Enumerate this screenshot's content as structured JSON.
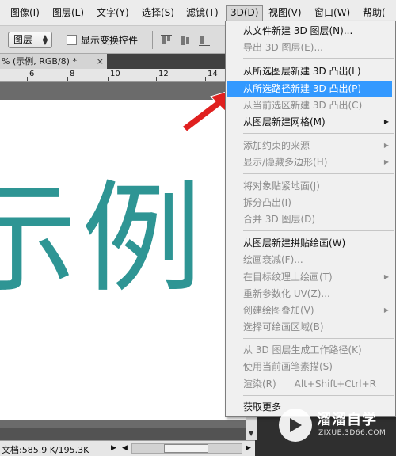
{
  "menubar": {
    "items": [
      "图像(I)",
      "图层(L)",
      "文字(Y)",
      "选择(S)",
      "滤镜(T)",
      "3D(D)",
      "视图(V)",
      "窗口(W)",
      "帮助("
    ]
  },
  "optionsbar": {
    "layer_select": "图层",
    "show_transform_label": "显示变换控件"
  },
  "document": {
    "tab_label": "% (示例, RGB/8) *",
    "tab_close": "×",
    "ruler_numbers": [
      "6",
      "8",
      "10",
      "12",
      "14"
    ],
    "canvas_text": "示例",
    "canvas_text_color": "#2e9594"
  },
  "status": {
    "text": "文档:585.9 K/195.3K"
  },
  "menu_3d": {
    "highlight_color": "#3399ff",
    "items": [
      {
        "label": "从文件新建 3D 图层(N)...",
        "enabled": true,
        "submenu": false,
        "highlight": false
      },
      {
        "label": "导出 3D 图层(E)...",
        "enabled": false,
        "submenu": false,
        "highlight": false
      },
      {
        "label": "从所选图层新建 3D 凸出(L)",
        "enabled": true,
        "submenu": false,
        "highlight": false
      },
      {
        "label": "从所选路径新建 3D 凸出(P)",
        "enabled": true,
        "submenu": false,
        "highlight": true
      },
      {
        "label": "从当前选区新建 3D 凸出(C)",
        "enabled": false,
        "submenu": false,
        "highlight": false
      },
      {
        "label": "从图层新建网格(M)",
        "enabled": true,
        "submenu": true,
        "highlight": false
      },
      {
        "label": "添加约束的来源",
        "enabled": false,
        "submenu": true,
        "highlight": false
      },
      {
        "label": "显示/隐藏多边形(H)",
        "enabled": false,
        "submenu": true,
        "highlight": false
      },
      {
        "label": "将对象贴紧地面(J)",
        "enabled": false,
        "submenu": false,
        "highlight": false
      },
      {
        "label": "拆分凸出(I)",
        "enabled": false,
        "submenu": false,
        "highlight": false
      },
      {
        "label": "合并 3D 图层(D)",
        "enabled": false,
        "submenu": false,
        "highlight": false
      },
      {
        "label": "从图层新建拼贴绘画(W)",
        "enabled": true,
        "submenu": false,
        "highlight": false
      },
      {
        "label": "绘画衰减(F)...",
        "enabled": false,
        "submenu": false,
        "highlight": false
      },
      {
        "label": "在目标纹理上绘画(T)",
        "enabled": false,
        "submenu": true,
        "highlight": false
      },
      {
        "label": "重新参数化 UV(Z)...",
        "enabled": false,
        "submenu": false,
        "highlight": false
      },
      {
        "label": "创建绘图叠加(V)",
        "enabled": false,
        "submenu": true,
        "highlight": false
      },
      {
        "label": "选择可绘画区域(B)",
        "enabled": false,
        "submenu": false,
        "highlight": false
      },
      {
        "label": "从 3D 图层生成工作路径(K)",
        "enabled": false,
        "submenu": false,
        "highlight": false
      },
      {
        "label": "使用当前画笔素描(S)",
        "enabled": false,
        "submenu": false,
        "highlight": false
      },
      {
        "label": "渲染(R)",
        "enabled": false,
        "submenu": false,
        "highlight": false,
        "shortcut": "Alt+Shift+Ctrl+R"
      },
      {
        "label": "获取更多",
        "enabled": true,
        "submenu": false,
        "highlight": false
      }
    ]
  },
  "watermark": {
    "title": "溜溜自学",
    "subtitle": "ZIXUE.3D66.COM"
  },
  "icons": {
    "submenu_arrow": "▶",
    "select_arrows": "▲▼",
    "scroll_left": "◀",
    "scroll_right": "▶",
    "scroll_down": "▼"
  }
}
